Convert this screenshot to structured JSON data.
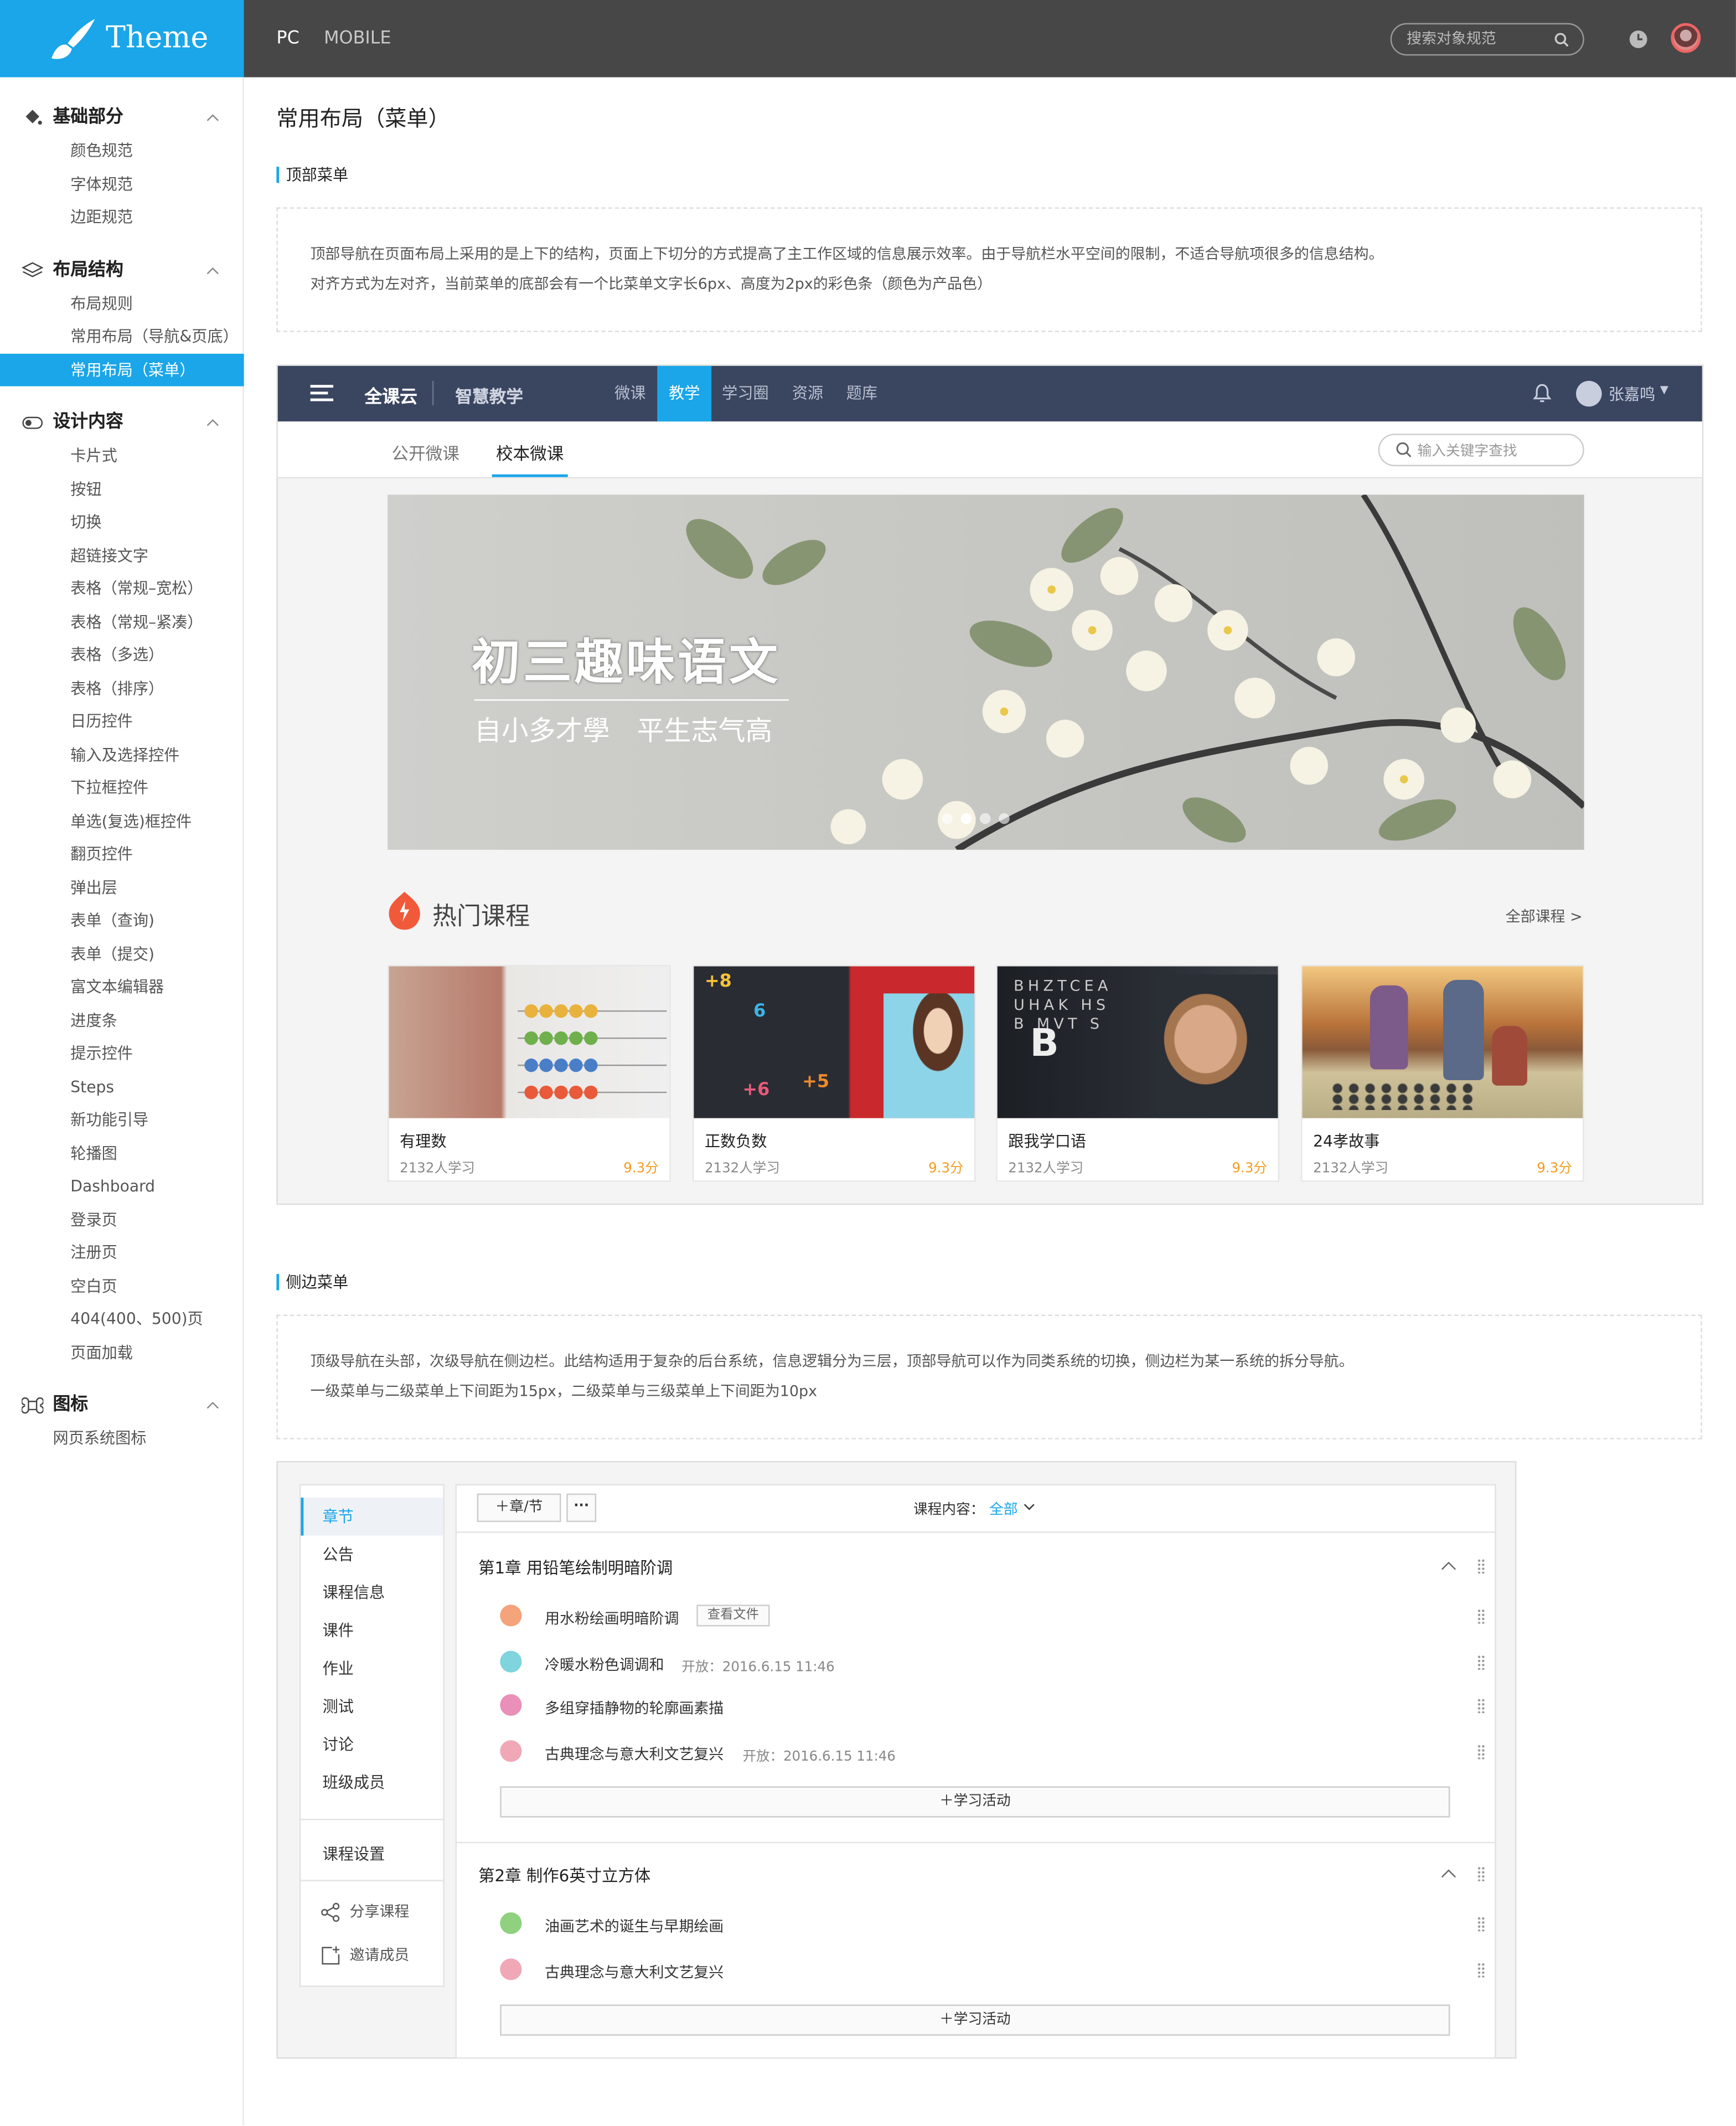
{
  "app": {
    "name": "Theme"
  },
  "topbar": {
    "tabs": [
      "PC",
      "MOBILE"
    ],
    "search_placeholder": "搜索对象规范"
  },
  "sidebar": {
    "groups": [
      {
        "label": "基础部分",
        "icon": "paint-bucket-icon",
        "items": [
          "颜色规范",
          "字体规范",
          "边距规范"
        ]
      },
      {
        "label": "布局结构",
        "icon": "layers-icon",
        "items": [
          "布局规则",
          "常用布局（导航&页底）",
          "常用布局（菜单）"
        ]
      },
      {
        "label": "设计内容",
        "icon": "toggle-icon",
        "items": [
          "卡片式",
          "按钮",
          "切换",
          "超链接文字",
          "表格（常规–宽松）",
          "表格（常规–紧凑）",
          "表格（多选）",
          "表格（排序）",
          "日历控件",
          "输入及选择控件",
          "下拉框控件",
          "单选(复选)框控件",
          "翻页控件",
          "弹出层",
          "表单（查询)",
          "表单（提交)",
          "富文本编辑器",
          "进度条",
          "提示控件",
          "Steps",
          "新功能引导",
          "轮播图",
          "Dashboard",
          "登录页",
          "注册页",
          "空白页",
          "404(400、500)页",
          "页面加载"
        ]
      },
      {
        "label": "图标",
        "icon": "command-icon",
        "items": [
          "网页系统图标"
        ]
      }
    ],
    "active_item": "常用布局（菜单）"
  },
  "page": {
    "title": "常用布局（菜单）",
    "section1": {
      "title": "顶部菜单",
      "desc": [
        "顶部导航在页面布局上采用的是上下的结构，页面上下切分的方式提高了主工作区域的信息展示效率。由于导航栏水平空间的限制，不适合导航项很多的信息结构。",
        "对齐方式为左对齐，当前菜单的底部会有一个比菜单文字长6px、高度为2px的彩色条（颜色为产品色）"
      ]
    },
    "section2": {
      "title": "侧边菜单",
      "desc": [
        "顶级导航在头部，次级导航在侧边栏。此结构适用于复杂的后台系统，信息逻辑分为三层，顶部导航可以作为同类系统的切换，侧边栏为某一系统的拆分导航。",
        "一级菜单与二级菜单上下间距为15px，二级菜单与三级菜单上下间距为10px"
      ]
    }
  },
  "demo1": {
    "brand": "全课云",
    "product": "智慧教学",
    "nav": [
      "微课",
      "教学",
      "学习圈",
      "资源",
      "题库"
    ],
    "nav_active": "教学",
    "user": "张嘉鸣",
    "tabs": [
      "公开微课",
      "校本微课"
    ],
    "tab_active": "校本微课",
    "search_placeholder": "输入关键字查找",
    "banner": {
      "title": "初三趣味语文",
      "subtitle": "自小多才學　平生志气高"
    },
    "hot": {
      "title": "热门课程",
      "all_link": "全部课程 >"
    },
    "courses": [
      {
        "name": "有理数",
        "learners": "2132人学习",
        "score": "9.3分"
      },
      {
        "name": "正数负数",
        "learners": "2132人学习",
        "score": "9.3分"
      },
      {
        "name": "跟我学口语",
        "learners": "2132人学习",
        "score": "9.3分"
      },
      {
        "name": "24孝故事",
        "learners": "2132人学习",
        "score": "9.3分"
      }
    ]
  },
  "demo2": {
    "menu": [
      "章节",
      "公告",
      "课程信息",
      "课件",
      "作业",
      "测试",
      "讨论",
      "班级成员"
    ],
    "menu_active": "章节",
    "settings": "课程设置",
    "share": "分享课程",
    "invite": "邀请成员",
    "toolbar": {
      "add": "章/节",
      "more": "···",
      "filter_label": "课程内容：",
      "filter_value": "全部"
    },
    "chapters": [
      {
        "title": "第1章 用铅笔绘制明暗阶调",
        "items": [
          {
            "name": "用水粉绘画明暗阶调",
            "tag": "查看文件",
            "meta": "",
            "color": "#f5a37a"
          },
          {
            "name": "冷暖水粉色调调和",
            "tag": "",
            "meta": "开放：2016.6.15 11:46",
            "color": "#7fd4de"
          },
          {
            "name": "多组穿插静物的轮廓画素描",
            "tag": "",
            "meta": "",
            "color": "#e98fb8"
          },
          {
            "name": "古典理念与意大利文艺复兴",
            "tag": "",
            "meta": "开放：2016.6.15 11:46",
            "color": "#f0a7b6"
          }
        ]
      },
      {
        "title": "第2章 制作6英寸立方体",
        "items": [
          {
            "name": "油画艺术的诞生与早期绘画",
            "tag": "",
            "meta": "",
            "color": "#8fd17f"
          },
          {
            "name": "古典理念与意大利文艺复兴",
            "tag": "",
            "meta": "",
            "color": "#f0a7b6"
          }
        ]
      }
    ],
    "add_activity": "学习活动"
  }
}
